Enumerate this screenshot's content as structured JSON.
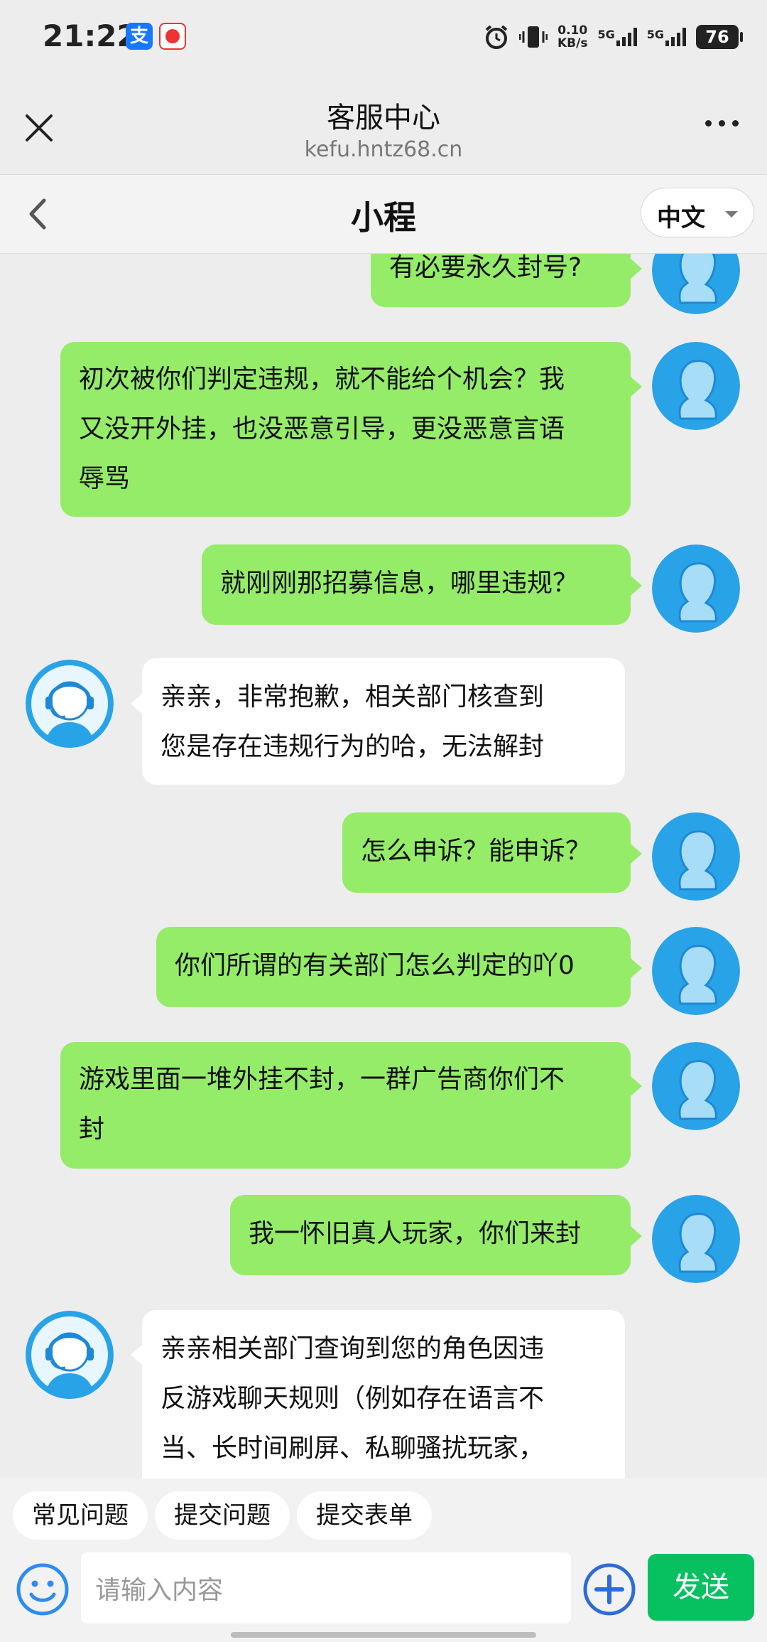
{
  "status_bar": {
    "time": "21:22",
    "alipay_icon_label": "支",
    "speed_value": "0.10",
    "speed_unit": "KB/s",
    "sim1": "5G",
    "sim2": "5G",
    "battery": "76"
  },
  "web": {
    "title": "客服中心",
    "url": "kefu.hntz68.cn"
  },
  "chat": {
    "title": "小程",
    "language": "中文"
  },
  "messages": [
    {
      "from": "user",
      "lines": [
        "有必要永久封号?"
      ]
    },
    {
      "from": "user",
      "lines": [
        "初次被你们判定违规，就不能给个机会？我",
        "又没开外挂，也没恶意引导，更没恶意言语",
        "辱骂"
      ]
    },
    {
      "from": "user",
      "lines": [
        "就刚刚那招募信息，哪里违规？"
      ]
    },
    {
      "from": "agent",
      "lines": [
        "亲亲，非常抱歉，相关部门核查到",
        "您是存在违规行为的哈，无法解封"
      ]
    },
    {
      "from": "user",
      "lines": [
        "怎么申诉？能申诉？"
      ]
    },
    {
      "from": "user",
      "lines": [
        "你们所谓的有关部门怎么判定的吖0"
      ]
    },
    {
      "from": "user",
      "lines": [
        "游戏里面一堆外挂不封，一群广告商你们不",
        "封"
      ]
    },
    {
      "from": "user",
      "lines": [
        "我一怀旧真人玩家，你们来封"
      ]
    },
    {
      "from": "agent",
      "lines": [
        "亲亲相关部门查询到您的角色因违",
        "反游戏聊天规则（例如存在语言不",
        "当、长时间刷屏、私聊骚扰玩家，"
      ]
    }
  ],
  "quick_actions": [
    "常见问题",
    "提交问题",
    "提交表单"
  ],
  "composer": {
    "placeholder": "请输入内容",
    "send_label": "发送"
  },
  "colors": {
    "user_bubble": "#95ec69",
    "agent_bubble": "#ffffff",
    "send_button": "#07c160",
    "avatar_blue": "#29a3e8"
  },
  "icons": [
    "close-icon",
    "more-icon",
    "back-icon",
    "caret-down-icon",
    "user-avatar-icon",
    "agent-avatar-icon",
    "emoji-icon",
    "plus-icon"
  ]
}
